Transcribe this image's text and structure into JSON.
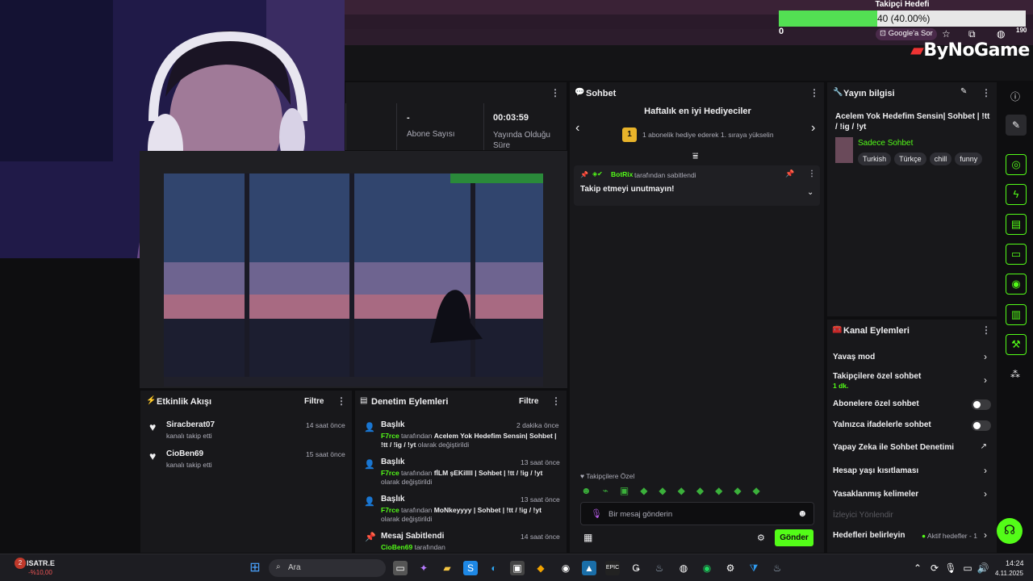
{
  "goal": {
    "title": "Takipçi Hedefi",
    "progress_text": "40 (40.00%)",
    "fraction": 0.4,
    "min": "0"
  },
  "browser": {
    "google_label": "Google'a Sor",
    "badge": "190"
  },
  "logo": {
    "text": "ByNoGame"
  },
  "stats": {
    "subs_value": "-",
    "subs_label": "Abone Sayısı",
    "live_value": "00:03:59",
    "live_label": "Yayında Olduğu Süre"
  },
  "activity": {
    "title": "Etkinlik Akışı",
    "filter": "Filtre",
    "items": [
      {
        "user": "Siracberat07",
        "action": "kanalı takip etti",
        "time": "14 saat önce"
      },
      {
        "user": "CioBen69",
        "action": "kanalı takip etti",
        "time": "15 saat önce"
      }
    ]
  },
  "mod": {
    "title": "Denetim Eylemleri",
    "filter": "Filtre",
    "items": [
      {
        "kind": "Başlık",
        "time": "2 dakika önce",
        "user": "F7rce",
        "mid": " tarafından ",
        "value": "Acelem Yok Hedefim Sensin| Sohbet | !tt / !ig / !yt",
        "tail": " olarak değiştirildi"
      },
      {
        "kind": "Başlık",
        "time": "13 saat önce",
        "user": "F7rce",
        "mid": " tarafından ",
        "value": "fİLM şEKillll | Sohbet | !tt / !ig / !yt",
        "tail": " olarak değiştirildi"
      },
      {
        "kind": "Başlık",
        "time": "13 saat önce",
        "user": "F7rce",
        "mid": " tarafından ",
        "value": "MoNkeyyyy | Sohbet | !tt / !ig / !yt",
        "tail": " olarak değiştirildi"
      },
      {
        "kind": "Mesaj Sabitlendi",
        "time": "14 saat önce",
        "user": "CioBen69",
        "mid": " tarafından",
        "value": "",
        "tail": ""
      }
    ]
  },
  "chat": {
    "title": "Sohbet",
    "gifters_title": "Haftalık en iyi Hediyeciler",
    "gifters_rank": "1",
    "gifters_text": "1 abonelik hediye ederek 1. sıraya yükselin",
    "pinned_user": "BotRix",
    "pinned_by": "tarafından sabitlendi",
    "pinned_message": "Takip etmeyi unutmayın!",
    "followers_only": "Takipçilere Özel",
    "input_placeholder": "Bir mesaj gönderin",
    "send": "Gönder"
  },
  "info": {
    "title": "Yayın bilgisi",
    "stream_title": "Acelem Yok Hedefim Sensin| Sohbet | !tt / !ig / !yt",
    "category": "Sadece Sohbet",
    "tags": [
      "Turkish",
      "Türkçe",
      "chill",
      "funny"
    ]
  },
  "actions": {
    "title": "Kanal Eylemleri",
    "slow_mode": "Yavaş mod",
    "followers_chat": "Takipçilere özel sohbet",
    "followers_chat_sub": "1 dk.",
    "subs_chat": "Abonelere özel sohbet",
    "emote_chat": "Yalnızca ifadelerle sohbet",
    "ai_mod": "Yapay Zeka ile Sohbet Denetimi",
    "age_limit": "Hesap yaşı kısıtlaması",
    "banned_words": "Yasaklanmış kelimeler",
    "viewer_guide": "İzleyici Yönlendir",
    "goals": "Hedefleri belirleyin",
    "goals_status": "Aktif hedefler - 1"
  },
  "taskbar": {
    "ticker_name": "ISATR.E",
    "ticker_change": "-%10,00",
    "ticker_badge": "2",
    "search": "Ara",
    "time": "14:24",
    "date": "4.11.2025"
  },
  "colors": {
    "accent": "#53fc18",
    "panel": "#18181b",
    "bg": "#0e0e10"
  }
}
